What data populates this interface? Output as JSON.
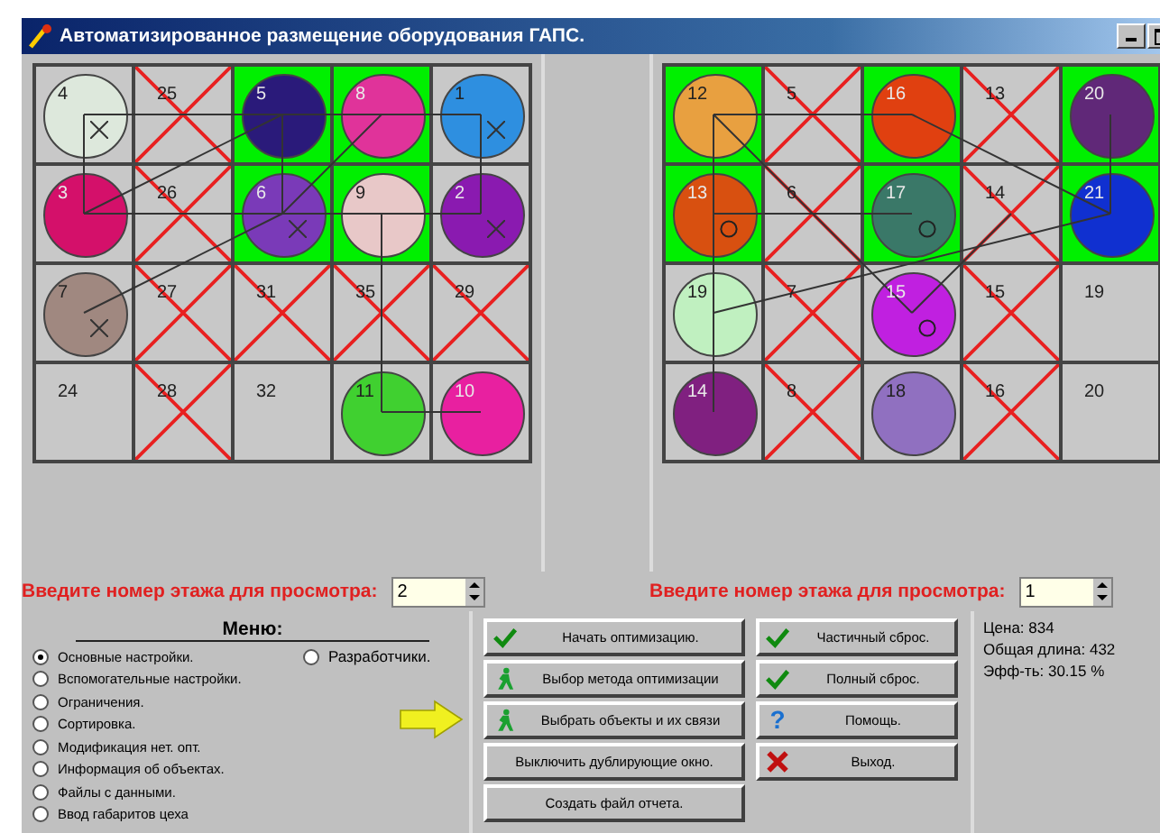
{
  "window": {
    "title": "Автоматизированное размещение оборудования ГАПС."
  },
  "floors": [
    {
      "cells": [
        {
          "number": "4",
          "crossed": false,
          "highlighted": false,
          "color": "#dde8dc",
          "kind": "cross"
        },
        {
          "number": "25",
          "crossed": true,
          "highlighted": false
        },
        {
          "number": "5",
          "crossed": false,
          "highlighted": true,
          "color": "#2a1a7a"
        },
        {
          "number": "8",
          "crossed": false,
          "highlighted": true,
          "color": "#e0339a"
        },
        {
          "number": "1",
          "crossed": false,
          "highlighted": false,
          "color": "#2e8fe0",
          "kind": "cross"
        },
        {
          "number": "3",
          "crossed": false,
          "highlighted": false,
          "color": "#d4106a"
        },
        {
          "number": "26",
          "crossed": true,
          "highlighted": false
        },
        {
          "number": "6",
          "crossed": false,
          "highlighted": true,
          "color": "#7a3ab8",
          "kind": "cross"
        },
        {
          "number": "9",
          "crossed": false,
          "highlighted": true,
          "color": "#e8c8c8"
        },
        {
          "number": "2",
          "crossed": false,
          "highlighted": false,
          "color": "#8a1ab0",
          "kind": "cross"
        },
        {
          "number": "7",
          "crossed": false,
          "highlighted": false,
          "color": "#a08880",
          "kind": "cross"
        },
        {
          "number": "27",
          "crossed": true,
          "highlighted": false
        },
        {
          "number": "31",
          "crossed": true,
          "highlighted": false
        },
        {
          "number": "35",
          "crossed": true,
          "highlighted": false
        },
        {
          "number": "29",
          "crossed": true,
          "highlighted": false
        },
        {
          "number": "24",
          "crossed": false,
          "highlighted": false
        },
        {
          "number": "28",
          "crossed": true,
          "highlighted": false
        },
        {
          "number": "32",
          "crossed": false,
          "highlighted": false
        },
        {
          "number": "11",
          "crossed": false,
          "highlighted": false,
          "color": "#40d030"
        },
        {
          "number": "10",
          "crossed": false,
          "highlighted": false,
          "color": "#e820a0"
        }
      ],
      "prompt": "Введите номер этажа для просмотра:",
      "floor_value": "2"
    },
    {
      "cells": [
        {
          "number": "12",
          "crossed": false,
          "highlighted": true,
          "color": "#e8a040"
        },
        {
          "number": "5",
          "crossed": true,
          "highlighted": false
        },
        {
          "number": "16",
          "crossed": false,
          "highlighted": true,
          "color": "#e04010"
        },
        {
          "number": "13",
          "crossed": true,
          "highlighted": false
        },
        {
          "number": "20",
          "crossed": false,
          "highlighted": true,
          "color": "#602878"
        },
        {
          "number": "13",
          "crossed": false,
          "highlighted": true,
          "color": "#d85010",
          "kind": "ring"
        },
        {
          "number": "6",
          "crossed": true,
          "highlighted": false
        },
        {
          "number": "17",
          "crossed": false,
          "highlighted": true,
          "color": "#3a7868",
          "kind": "ring"
        },
        {
          "number": "14",
          "crossed": true,
          "highlighted": false
        },
        {
          "number": "21",
          "crossed": false,
          "highlighted": true,
          "color": "#1030d0"
        },
        {
          "number": "19",
          "crossed": false,
          "highlighted": false,
          "color": "#c0f0c0"
        },
        {
          "number": "7",
          "crossed": true,
          "highlighted": false
        },
        {
          "number": "15",
          "crossed": false,
          "highlighted": false,
          "color": "#c020e0",
          "kind": "ring"
        },
        {
          "number": "15",
          "crossed": true,
          "highlighted": false
        },
        {
          "number": "19",
          "crossed": false,
          "highlighted": false
        },
        {
          "number": "14",
          "crossed": false,
          "highlighted": false,
          "color": "#802080"
        },
        {
          "number": "8",
          "crossed": true,
          "highlighted": false
        },
        {
          "number": "18",
          "crossed": false,
          "highlighted": false,
          "color": "#9070c0"
        },
        {
          "number": "16",
          "crossed": true,
          "highlighted": false
        },
        {
          "number": "20",
          "crossed": false,
          "highlighted": false
        }
      ],
      "prompt": "Введите номер этажа для просмотра:",
      "floor_value": "1"
    }
  ],
  "menu": {
    "title": "Меню:",
    "items": [
      {
        "label": "Основные настройки.",
        "selected": true
      },
      {
        "label": "Вспомогательные настройки.",
        "selected": false
      },
      {
        "label": "Ограничения.",
        "selected": false
      },
      {
        "label": "Сортировка.",
        "selected": false
      },
      {
        "label": "Модификация нет. опт.",
        "selected": false
      },
      {
        "label": "Информация об объектах.",
        "selected": false
      },
      {
        "label": "Файлы с данными.",
        "selected": false
      },
      {
        "label": "Ввод габаритов цеха",
        "selected": false
      }
    ],
    "side_items": [
      {
        "label": "Разработчики.",
        "selected": false
      }
    ]
  },
  "buttons_left": [
    {
      "label": "Начать оптимизацию.",
      "kind": "check"
    },
    {
      "label": "Выбор метода оптимизации",
      "kind": "runner"
    },
    {
      "label": "Выбрать объекты и их связи",
      "kind": "runner"
    },
    {
      "label": "Выключить дублирующие окно."
    },
    {
      "label": "Создать файл отчета."
    }
  ],
  "buttons_right": [
    {
      "label": "Частичный сброс.",
      "kind": "check"
    },
    {
      "label": "Полный сброс.",
      "kind": "check"
    },
    {
      "label": "Помощь.",
      "kind": "help",
      "symbol": "?"
    },
    {
      "label": "Выход.",
      "kind": "exit"
    }
  ],
  "stats": [
    "Цена: 834",
    "Общая длина: 432",
    "Эфф-ть: 30.15  %"
  ]
}
